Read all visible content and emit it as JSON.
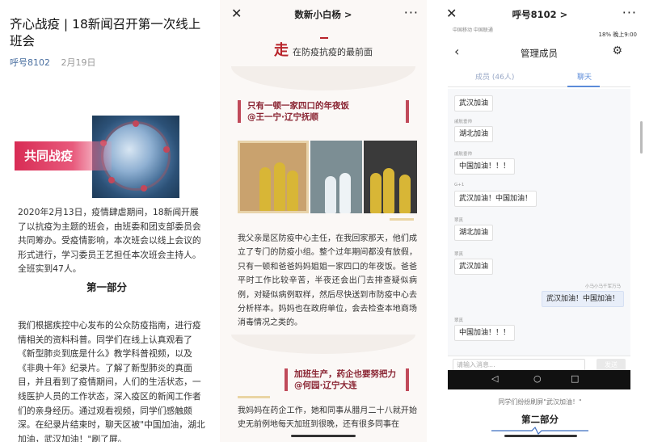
{
  "article": {
    "title": "齐心战疫 | 18新闻召开第一次线上班会",
    "account": "呼号8102",
    "date": "2月19日",
    "banner_text": "共同战疫",
    "para1": "2020年2月13日，疫情肆虐期间，18新闻开展了以抗疫为主题的班会，由班委和团支部委员会共同筹办。受疫情影响，本次班会以线上会议的形式进行，学习委员王艺担任本次班会主持人。全班实到47人。",
    "section1": "第一部分",
    "para2": "我们根据疾控中心发布的公众防疫指南，进行疫情相关的资料科普。同学们在线上认真观看了《新型肺炎到底是什么》教学科普视频，以及《非典十年》纪录片。了解了新型肺炎的真面目，并且看到了疫情期间，人们的生活状态，一线医护人员的工作状态，深入疫区的新闻工作者们的亲身经历。通过观看视频，同学们感触颇深。在纪录片结束时，聊天区被\"中国加油，湖北加油，武汉加油！\"刷了屏。"
  },
  "panel2": {
    "close_icon": "close-icon",
    "title": "数新小白杨 >",
    "more": "···",
    "heading_big": "走",
    "heading_rest": "在防疫抗疫的最前面",
    "quote1_line1": "只有一顿一家四口的年夜饭",
    "quote1_line2": "@王一宁·辽宁抚顺",
    "para1": "我父亲是区防疫中心主任，在我回家那天，他们成立了专门的防疫小组。整个过年期间都没有放假，只有一顿和爸爸妈妈姐姐一家四口的年夜饭。爸爸平时工作比较辛苦，半夜还会出门去排查疑似病例，对疑似病例取样，然后尽快送到市防疫中心去分析样本。妈妈也在政府单位，会去检查本地商场消毒情况之类的。",
    "quote2_line1": "加班生产，药企也要努把力",
    "quote2_line2": "@何园·辽宁大连",
    "para2": "我妈妈在药企工作，她和同事从腊月二十八就开始史无前例地每天加班到很晚，还有很多同事在"
  },
  "panel3": {
    "title": "呼号8102 >",
    "more": "···",
    "status_left": "中国移动 中国联通",
    "status_right": "18% 晚上9:00",
    "header_title": "管理成员",
    "tab_members": "成员 (46人)",
    "tab_chat": "聊天",
    "messages": [
      {
        "sender": "",
        "text": "武汉加油",
        "mine": false
      },
      {
        "sender": "戚航垂帅",
        "text": "湖北加油",
        "mine": false
      },
      {
        "sender": "戚航垂帅",
        "text": "中国加油！！！",
        "mine": false
      },
      {
        "sender": "G+1",
        "text": "武汉加油！中国加油！",
        "mine": false
      },
      {
        "sender": "翠真",
        "text": "湖北加油",
        "mine": false
      },
      {
        "sender": "翠真",
        "text": "武汉加油",
        "mine": false
      },
      {
        "sender": "小马小马千军万马",
        "text": "武汉加油！中国加油！",
        "mine": true
      },
      {
        "sender": "翠真",
        "text": "中国加油！！！",
        "mine": false
      }
    ],
    "input_placeholder": "请输入消息...",
    "send_label": "发送",
    "caption": "同学们纷纷刷屏\"武汉加油！\"",
    "section2": "第二部分"
  }
}
